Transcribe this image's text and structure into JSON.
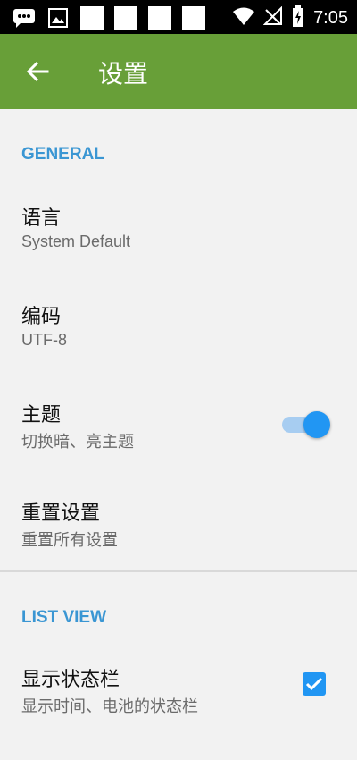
{
  "status_bar": {
    "time": "7:05",
    "icons": [
      "message-icon",
      "image-icon",
      "blank-notification",
      "blank-notification",
      "blank-notification",
      "blank-notification",
      "wifi-icon",
      "no-signal-icon",
      "battery-charging-icon"
    ]
  },
  "app_bar": {
    "title": "设置",
    "back_icon": "back-arrow-icon",
    "color": "#689f38"
  },
  "sections": {
    "general": {
      "header": "GENERAL",
      "items": [
        {
          "title": "语言",
          "subtitle": "System Default"
        },
        {
          "title": "编码",
          "subtitle": "UTF-8"
        },
        {
          "title": "主题",
          "subtitle": "切换暗、亮主题",
          "switch_on": true
        },
        {
          "title": "重置设置",
          "subtitle": "重置所有设置"
        }
      ]
    },
    "list_view": {
      "header": "LIST VIEW",
      "items": [
        {
          "title": "显示状态栏",
          "subtitle": "显示时间、电池的状态栏",
          "checked": true
        }
      ]
    }
  },
  "colors": {
    "accent": "#2196f3",
    "section_header": "#3a96d3",
    "background": "#f2f2f2"
  }
}
